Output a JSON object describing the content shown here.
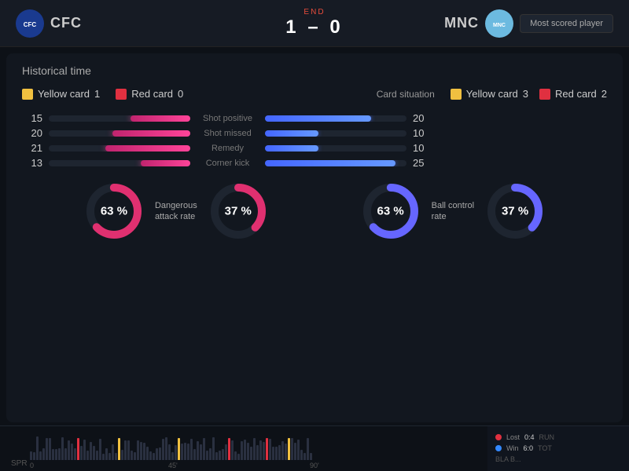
{
  "header": {
    "status": "End",
    "team_left": "CFC",
    "team_right": "MNC",
    "score": "1 – 0",
    "most_scored_label": "Most scored player"
  },
  "section_title": "Historical time",
  "left_team": {
    "yellow_card_label": "Yellow card",
    "yellow_card_count": "1",
    "red_card_label": "Red card",
    "red_card_count": "0"
  },
  "right_team": {
    "card_situation_label": "Card situation",
    "yellow_card_label": "Yellow card",
    "yellow_card_count": "3",
    "red_card_label": "Red card",
    "red_card_count": "2"
  },
  "stats": [
    {
      "num_left": "15",
      "label": "Shot positive",
      "num_right": "20",
      "left_pct": 42,
      "right_pct": 75
    },
    {
      "num_left": "20",
      "label": "Shot missed",
      "num_right": "10",
      "left_pct": 55,
      "right_pct": 38
    },
    {
      "num_left": "21",
      "label": "Remedy",
      "num_right": "10",
      "left_pct": 60,
      "right_pct": 38
    },
    {
      "num_left": "13",
      "label": "Corner kick",
      "num_right": "25",
      "left_pct": 35,
      "right_pct": 92
    }
  ],
  "donuts": [
    {
      "id": "dangerous-attack",
      "label": "Dangerous\nattack rate",
      "left_pct": 63,
      "right_pct": 37,
      "color_left": "#e03070",
      "color_right": "#e03070"
    },
    {
      "id": "ball-control",
      "label": "Ball control\nrate",
      "left_pct": 63,
      "right_pct": 37,
      "color_left": "#6666ff",
      "color_right": "#6666ff"
    }
  ],
  "timeline": {
    "spr_label": "SPR",
    "end_label": "90'",
    "legend": [
      {
        "color": "#e03040",
        "label": "Lost",
        "val1": "0:4",
        "val2": "RUN"
      },
      {
        "color": "#3388ff",
        "label": "Win",
        "val1": "6:0",
        "val2": "TOT"
      },
      {
        "extra": "BLA B..."
      }
    ]
  }
}
